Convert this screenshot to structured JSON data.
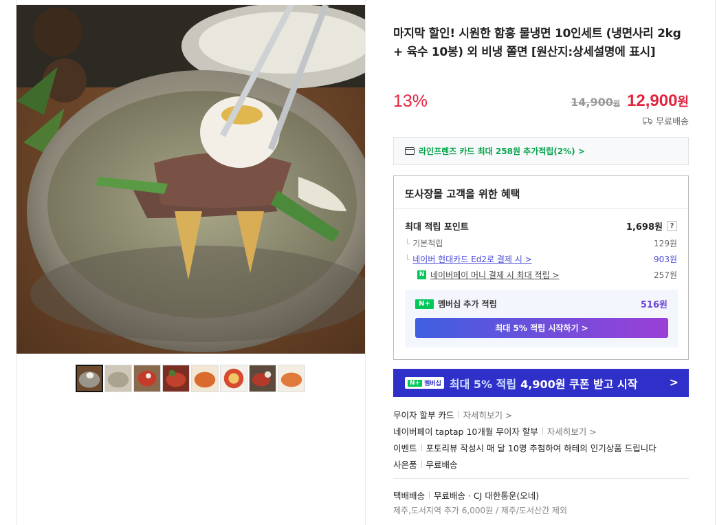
{
  "product": {
    "title": "마지막 할인! 시원한 함흥 물냉면 10인세트 (냉면사리 2kg + 육수 10봉) 외 비냉 쫄면 [원산지:상세설명에 표시]",
    "discount_rate": "13%",
    "original_price": "14,900",
    "original_unit": "원",
    "sale_price": "12,900",
    "sale_unit": "원",
    "shipping_tag": "무료배송"
  },
  "card_promo": {
    "text": "라인프렌즈 카드 최대 258원 추가적립(2%) >",
    "icon": "credit-card-icon"
  },
  "benefit": {
    "title": "또사장몰 고객을 위한 혜택",
    "max_points_label": "최대 적립 포인트",
    "max_points_value": "1,698원",
    "help_label": "?",
    "basic_label": "기본적립",
    "basic_value": "129원",
    "card_label": "네이버 현대카드 Ed2로 결제 시 >",
    "card_value": "903원",
    "npay_label": "네이버페이 머니 결제 시 최대 적립 >",
    "npay_value": "257원",
    "member_label": "멤버십 추가 적립",
    "member_value": "516원",
    "start_button": "최대 5% 적립 시작하기 >"
  },
  "membership_banner": {
    "badge_text": "멤버십",
    "text": "최대 5% 적립",
    "text2": "4,900원 쿠폰 받고 시작",
    "arrow": ">"
  },
  "info": {
    "installment_label": "무이자 할부 카드",
    "installment_more": "자세히보기 >",
    "npay_installment_label": "네이버페이 taptap 10개월 무이자 할부",
    "npay_installment_more": "자세히보기 >",
    "event_label": "이벤트",
    "event_text": "포토리뷰 작성시 매 달 10명 추첨하여 하테의 인기상품 드립니다",
    "gift_label": "사은품",
    "gift_text": "무료배송",
    "delivery_label": "택배배송",
    "delivery_text": "무료배송 · CJ 대한통운(오네)",
    "delivery_note": "제주,도서지역 추가 6,000원 / 제주/도서산간 제외"
  },
  "colors": {
    "sale_red": "#e2243e",
    "naver_green": "#03c75a",
    "membership_blue": "#2f2fc9",
    "link_blue": "#4b4bd8",
    "member_purple": "#6b43d8"
  }
}
